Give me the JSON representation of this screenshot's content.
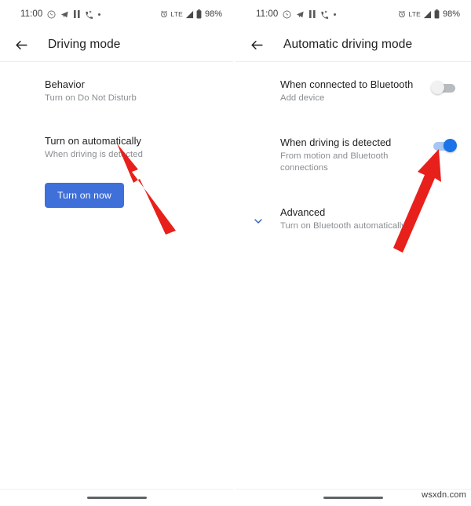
{
  "colors": {
    "accent_blue": "#3f6fd8",
    "toggle_on": "#1a73e8",
    "toggle_on_track": "#a7c7f2",
    "toggle_off_track": "#b9bcbf",
    "arrow_red": "#e8201b",
    "chevron_blue": "#2f5bb7",
    "title_text": "#1f1f1f",
    "subtitle_text": "#8a8d91"
  },
  "watermark": "wsxdn.com",
  "left_screen": {
    "status_bar": {
      "time": "11:00",
      "left_icons": [
        "whatsapp-icon",
        "telegram-icon",
        "pause-icon",
        "missed-call-icon",
        "dot-icon"
      ],
      "alarm_icon": "alarm-icon",
      "network": "LTE",
      "signal_icon": "signal-bars-icon",
      "battery_icon": "battery-icon",
      "battery_level": "98%"
    },
    "app_bar": {
      "back_icon": "back-arrow-icon",
      "title": "Driving mode"
    },
    "rows": [
      {
        "title": "Behavior",
        "subtitle": "Turn on Do Not Disturb"
      },
      {
        "title": "Turn on automatically",
        "subtitle": "When driving is detected"
      }
    ],
    "button": {
      "label": "Turn on now"
    },
    "annotation_arrow": "red-arrow-pointing-to-turn-on-automatically"
  },
  "right_screen": {
    "status_bar": {
      "time": "11:00",
      "left_icons": [
        "whatsapp-icon",
        "telegram-icon",
        "pause-icon",
        "missed-call-icon",
        "dot-icon"
      ],
      "alarm_icon": "alarm-icon",
      "network": "LTE",
      "signal_icon": "signal-bars-icon",
      "battery_icon": "battery-icon",
      "battery_level": "98%"
    },
    "app_bar": {
      "back_icon": "back-arrow-icon",
      "title": "Automatic driving mode"
    },
    "rows": [
      {
        "title": "When connected to Bluetooth",
        "subtitle": "Add device",
        "toggle": "off"
      },
      {
        "title": "When driving is detected",
        "subtitle": "From motion and Bluetooth connections",
        "toggle": "on"
      },
      {
        "title": "Advanced",
        "subtitle": "Turn on Bluetooth automatically",
        "lead_icon": "chevron-down-icon"
      }
    ],
    "annotation_arrow": "red-arrow-pointing-to-driving-detected-toggle"
  }
}
